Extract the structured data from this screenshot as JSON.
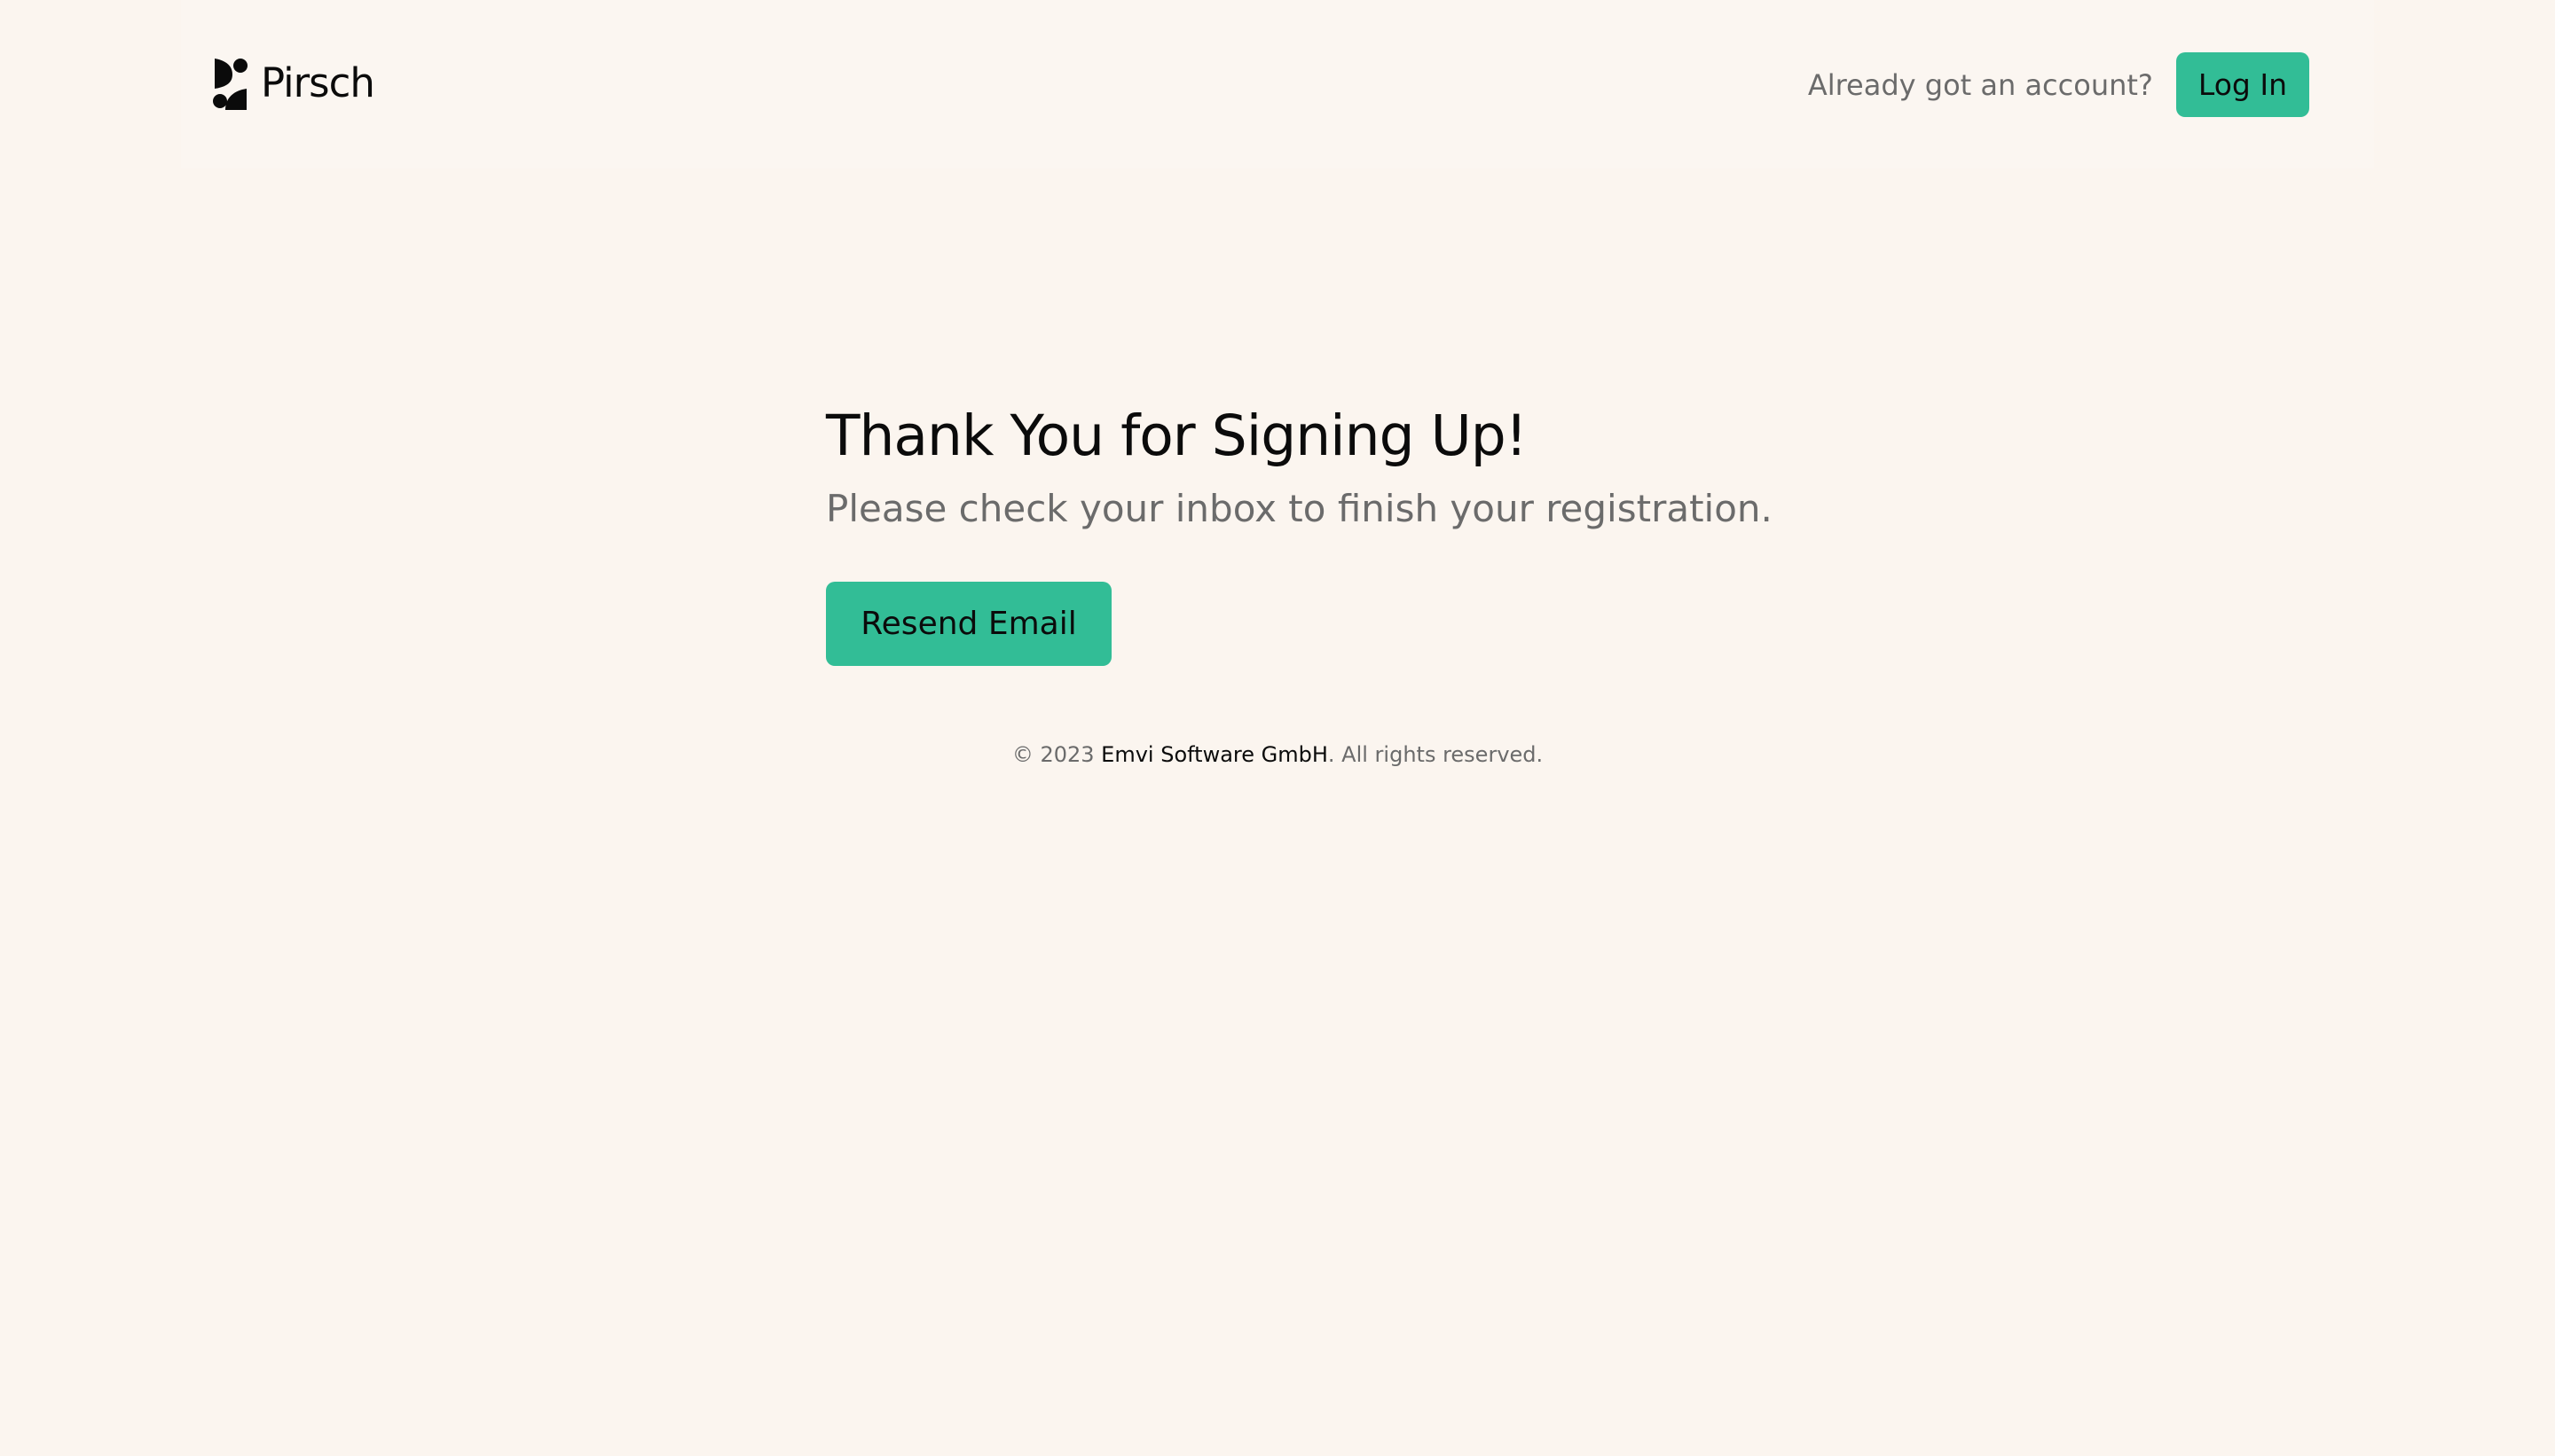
{
  "header": {
    "brand_name": "Pirsch",
    "account_prompt": "Already got an account?",
    "login_label": "Log In"
  },
  "main": {
    "title": "Thank You for Signing Up!",
    "subtitle": "Please check your inbox to finish your registration.",
    "resend_label": "Resend Email"
  },
  "footer": {
    "copyright_prefix": "© 2023",
    "company": "Emvi Software GmbH",
    "rights": ". All rights reserved."
  },
  "colors": {
    "background": "#fbf5ef",
    "accent": "#32bd96",
    "text_primary": "#0b0b0b",
    "text_muted": "#6b6b6b"
  },
  "icons": {
    "logo": "pirsch-logo-icon"
  }
}
